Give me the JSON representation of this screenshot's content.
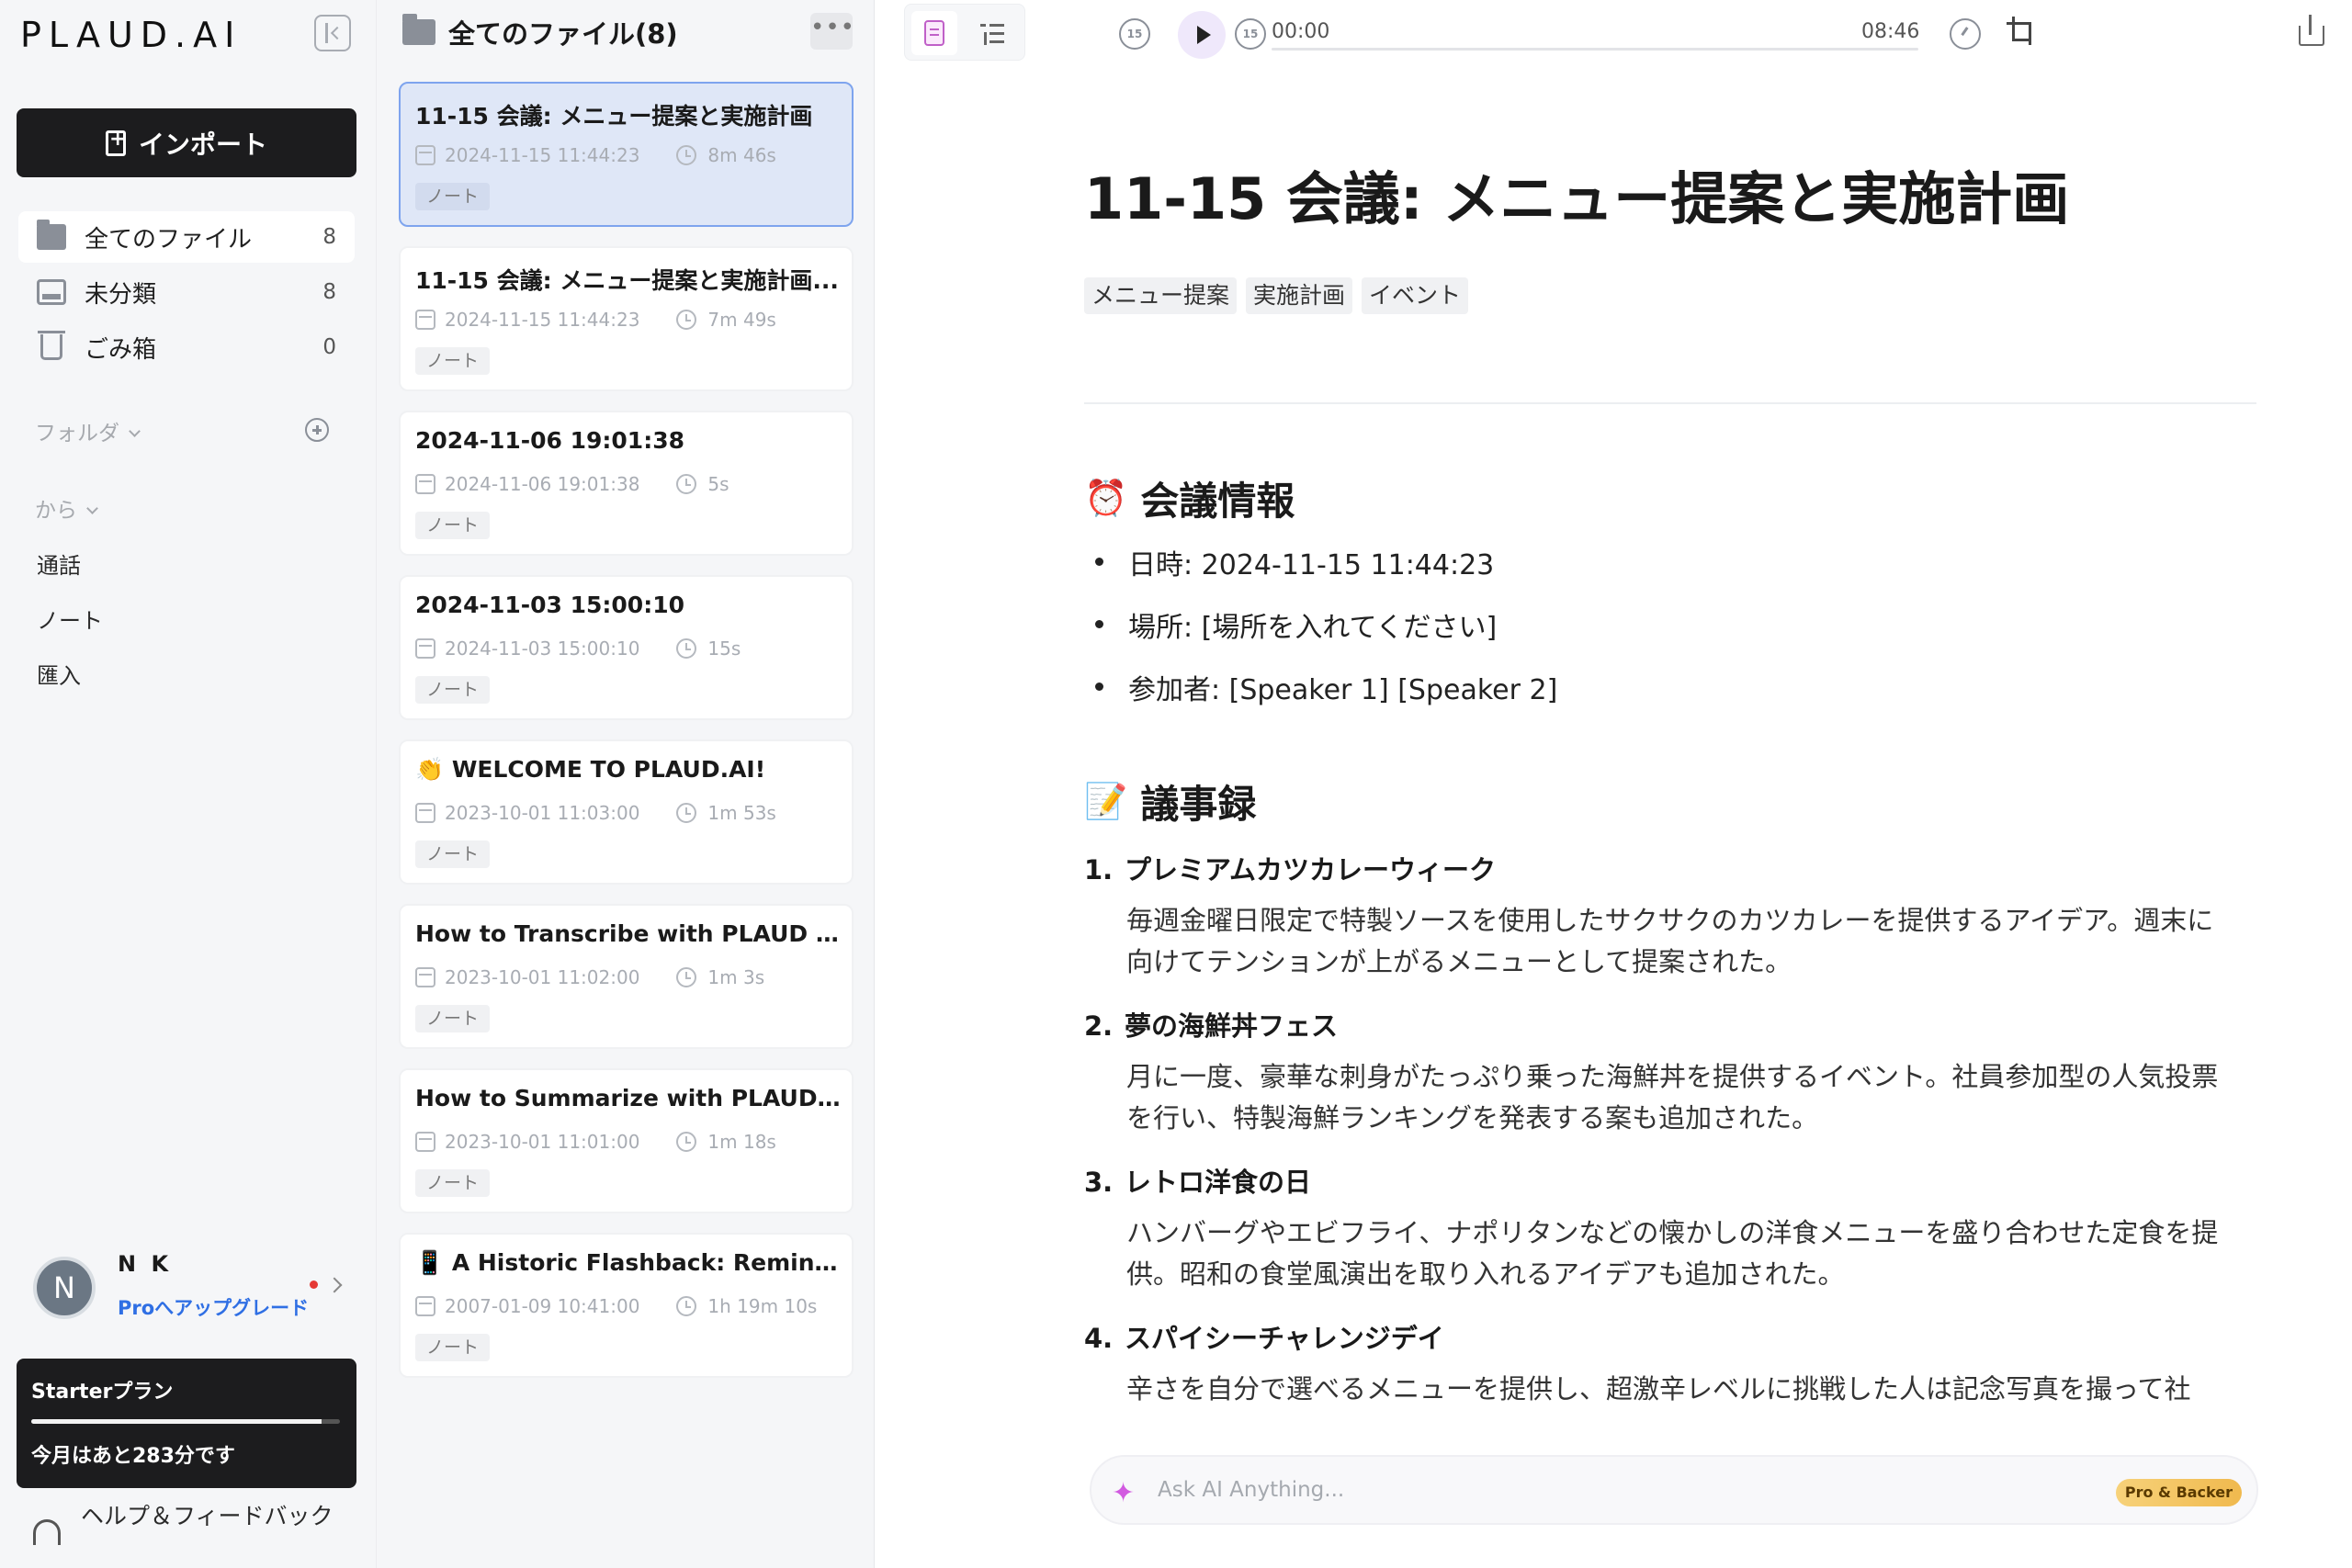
{
  "app": {
    "logo": "PLAUD.AI"
  },
  "sidebar": {
    "import_label": "インポート",
    "nav": [
      {
        "label": "全てのファイル",
        "count": "8",
        "icon": "folder-icon"
      },
      {
        "label": "未分類",
        "count": "8",
        "icon": "inbox-icon"
      },
      {
        "label": "ごみ箱",
        "count": "0",
        "icon": "trash-icon"
      }
    ],
    "folder_label": "フォルダ",
    "from_label": "から",
    "sources": [
      "通話",
      "ノート",
      "匯入"
    ],
    "user": {
      "initial": "N",
      "name": "N K",
      "upgrade": "Proへアップグレード"
    },
    "plan": {
      "name": "Starterプラン",
      "remaining": "今月はあと283分です",
      "usage_fraction": 0.94
    },
    "help": "ヘルプ＆フィードバック"
  },
  "filelist": {
    "title": "全てのファイル(8)",
    "more": "•••",
    "files": [
      {
        "title": "11-15 会議: メニュー提案と実施計画",
        "date": "2024-11-15 11:44:23",
        "duration": "8m 46s",
        "tag": "ノート"
      },
      {
        "title": "11-15 会議: メニュー提案と実施計画...",
        "date": "2024-11-15 11:44:23",
        "duration": "7m 49s",
        "tag": "ノート"
      },
      {
        "title": "2024-11-06 19:01:38",
        "date": "2024-11-06 19:01:38",
        "duration": "5s",
        "tag": "ノート"
      },
      {
        "title": "2024-11-03 15:00:10",
        "date": "2024-11-03 15:00:10",
        "duration": "15s",
        "tag": "ノート"
      },
      {
        "title": "👏 WELCOME TO PLAUD.AI!",
        "date": "2023-10-01 11:03:00",
        "duration": "1m 53s",
        "tag": "ノート"
      },
      {
        "title": "How to Transcribe with PLAUD De...",
        "date": "2023-10-01 11:02:00",
        "duration": "1m 3s",
        "tag": "ノート"
      },
      {
        "title": "How to Summarize with PLAUD D...",
        "date": "2023-10-01 11:01:00",
        "duration": "1m 18s",
        "tag": "ノート"
      },
      {
        "title": "📱 A Historic Flashback: Reminisc...",
        "date": "2007-01-09 10:41:00",
        "duration": "1h 19m 10s",
        "tag": "ノート"
      }
    ]
  },
  "player": {
    "current": "00:00",
    "total": "08:46",
    "skip_back": "15",
    "skip_fwd": "15",
    "progress_fraction": 0
  },
  "note": {
    "title": "11-15 会議: メニュー提案と実施計画",
    "tags": [
      "メニュー提案",
      "実施計画",
      "イベント"
    ],
    "info_heading": "会議情報",
    "info_emoji": "⏰",
    "info": [
      "日時:   2024-11-15 11:44:23",
      "場所: [場所を入れてください]",
      "参加者: [Speaker 1] [Speaker 2]"
    ],
    "minutes_heading": "議事録",
    "minutes_emoji": "📝",
    "minutes": [
      {
        "num": "1.",
        "title": "プレミアムカツカレーウィーク",
        "body": "毎週金曜日限定で特製ソースを使用したサクサクのカツカレーを提供するアイデア。週末に向けてテンションが上がるメニューとして提案された。"
      },
      {
        "num": "2.",
        "title": "夢の海鮮丼フェス",
        "body": "月に一度、豪華な刺身がたっぷり乗った海鮮丼を提供するイベント。社員参加型の人気投票を行い、特製海鮮ランキングを発表する案も追加された。"
      },
      {
        "num": "3.",
        "title": "レトロ洋食の日",
        "body": "ハンバーグやエビフライ、ナポリタンなどの懐かしの洋食メニューを盛り合わせた定食を提供。昭和の食堂風演出を取り入れるアイデアも追加された。"
      },
      {
        "num": "4.",
        "title": "スパイシーチャレンジデイ",
        "body": "辛さを自分で選べるメニューを提供し、超激辛レベルに挑戦した人は記念写真を撮って社"
      }
    ]
  },
  "ask_ai": {
    "placeholder": "Ask AI Anything...",
    "badge": "Pro & Backer"
  }
}
